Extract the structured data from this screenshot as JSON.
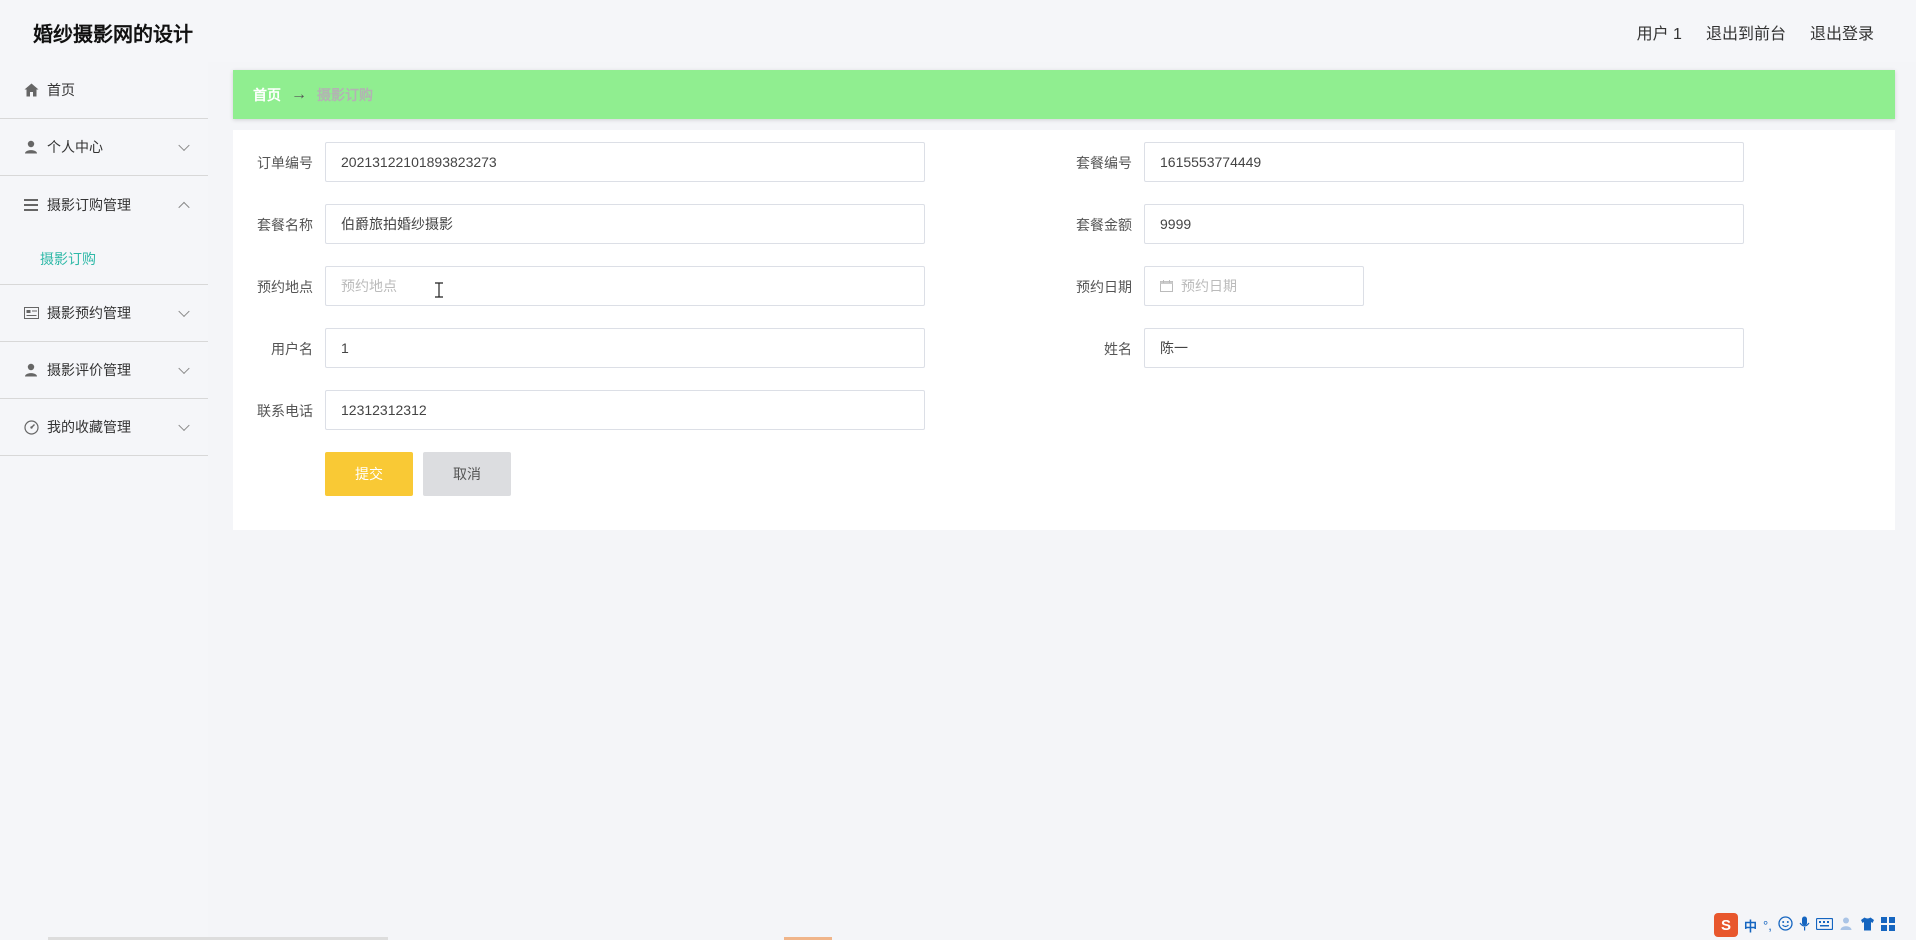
{
  "header": {
    "title": "婚纱摄影网的设计",
    "user": "用户 1",
    "exit_front": "退出到前台",
    "logout": "退出登录"
  },
  "sidebar": {
    "items": [
      {
        "label": "首页",
        "icon": "home-icon"
      },
      {
        "label": "个人中心",
        "icon": "user-icon"
      },
      {
        "label": "摄影订购管理",
        "icon": "list-icon",
        "open": true,
        "children": [
          {
            "label": "摄影订购"
          }
        ]
      },
      {
        "label": "摄影预约管理",
        "icon": "card-icon"
      },
      {
        "label": "摄影评价管理",
        "icon": "user-icon"
      },
      {
        "label": "我的收藏管理",
        "icon": "gauge-icon"
      }
    ]
  },
  "breadcrumb": {
    "home": "首页",
    "separator": "→",
    "current": "摄影订购"
  },
  "form": {
    "order_no": {
      "label": "订单编号",
      "value": "20213122101893823273"
    },
    "package_no": {
      "label": "套餐编号",
      "value": "1615553774449"
    },
    "package_name": {
      "label": "套餐名称",
      "value": "伯爵旅拍婚纱摄影"
    },
    "package_amount": {
      "label": "套餐金额",
      "value": "9999"
    },
    "location": {
      "label": "预约地点",
      "placeholder": "预约地点"
    },
    "date": {
      "label": "预约日期",
      "placeholder": "预约日期"
    },
    "username": {
      "label": "用户名",
      "value": "1"
    },
    "name": {
      "label": "姓名",
      "value": "陈一"
    },
    "phone": {
      "label": "联系电话",
      "value": "12312312312"
    }
  },
  "buttons": {
    "submit": "提交",
    "cancel": "取消"
  },
  "ime": {
    "logo": "S",
    "lang": "中",
    "punct": "°,"
  },
  "colors": {
    "breadcrumb_bg": "#90ee90",
    "submit_bg": "#f9c935",
    "cancel_bg": "#dcdde0",
    "active_menu": "#2fb9a8"
  }
}
